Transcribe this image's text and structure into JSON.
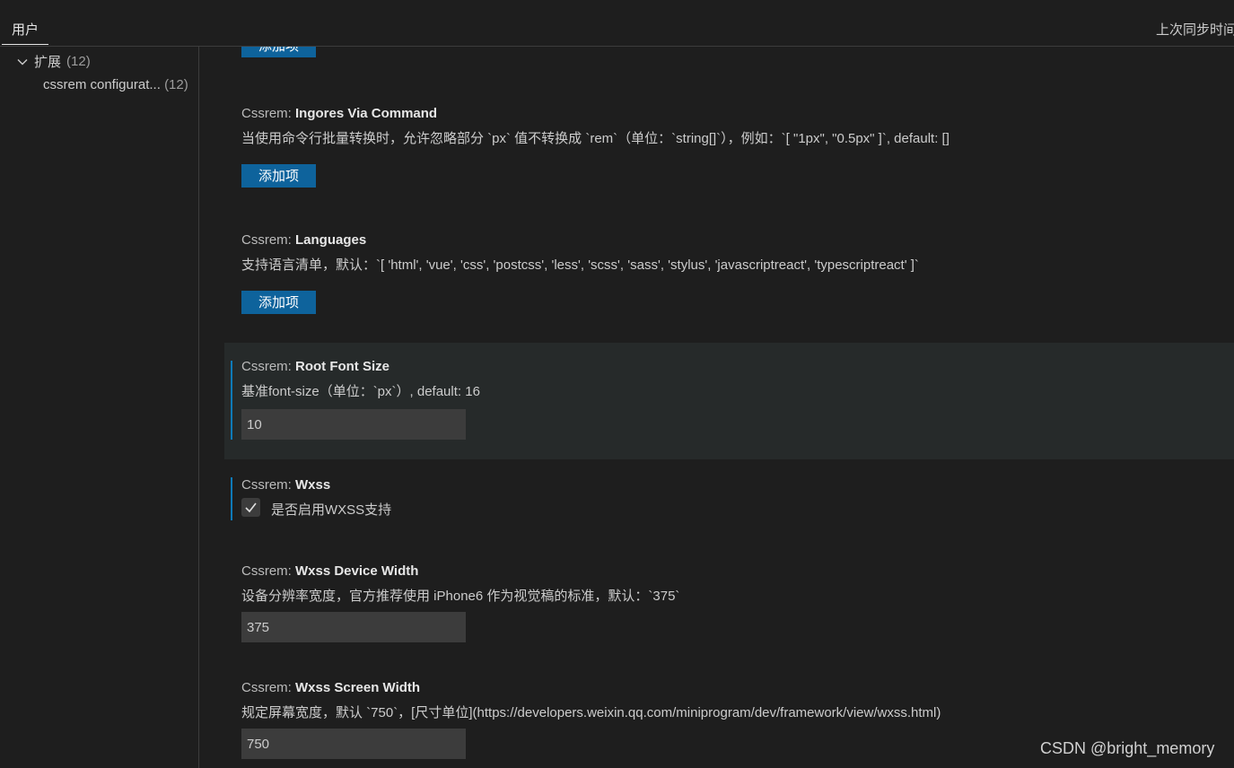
{
  "header": {
    "tab_label": "用户",
    "sync_status": "上次同步时间"
  },
  "toc": {
    "group_label": "扩展",
    "group_count": "(12)",
    "item_label": "cssrem configurat...",
    "item_count": "(12)"
  },
  "settings": {
    "add_item_label": "添加项",
    "ignores_via_command": {
      "category": "Cssrem: ",
      "name": "Ingores Via Command",
      "description": "当使用命令行批量转换时，允许忽略部分 `px` 值不转换成 `rem`（单位：`string[]`），例如：`[ \"1px\", \"0.5px\" ]`, default: []",
      "button": "添加项"
    },
    "languages": {
      "category": "Cssrem: ",
      "name": "Languages",
      "description": "支持语言清单，默认：`[ 'html', 'vue', 'css', 'postcss', 'less', 'scss', 'sass', 'stylus', 'javascriptreact', 'typescriptreact' ]`",
      "button": "添加项"
    },
    "root_font_size": {
      "category": "Cssrem: ",
      "name": "Root Font Size",
      "description": "基准font-size（单位：`px`）, default: 16",
      "value": "10"
    },
    "wxss": {
      "category": "Cssrem: ",
      "name": "Wxss",
      "checkbox_label": "是否启用WXSS支持",
      "checked": true
    },
    "wxss_device_width": {
      "category": "Cssrem: ",
      "name": "Wxss Device Width",
      "description": "设备分辨率宽度，官方推荐使用 iPhone6 作为视觉稿的标准，默认：`375`",
      "value": "375"
    },
    "wxss_screen_width": {
      "category": "Cssrem: ",
      "name": "Wxss Screen Width",
      "description": "规定屏幕宽度，默认 `750`，[尺寸单位](https://developers.weixin.qq.com/miniprogram/dev/framework/view/wxss.html)",
      "value": "750"
    }
  },
  "watermark": "CSDN @bright_memory",
  "colors": {
    "background": "#1e1e1e",
    "button": "#0e639c",
    "focus_bar": "#0e7ab8",
    "input_bg": "#3c3c3c"
  }
}
